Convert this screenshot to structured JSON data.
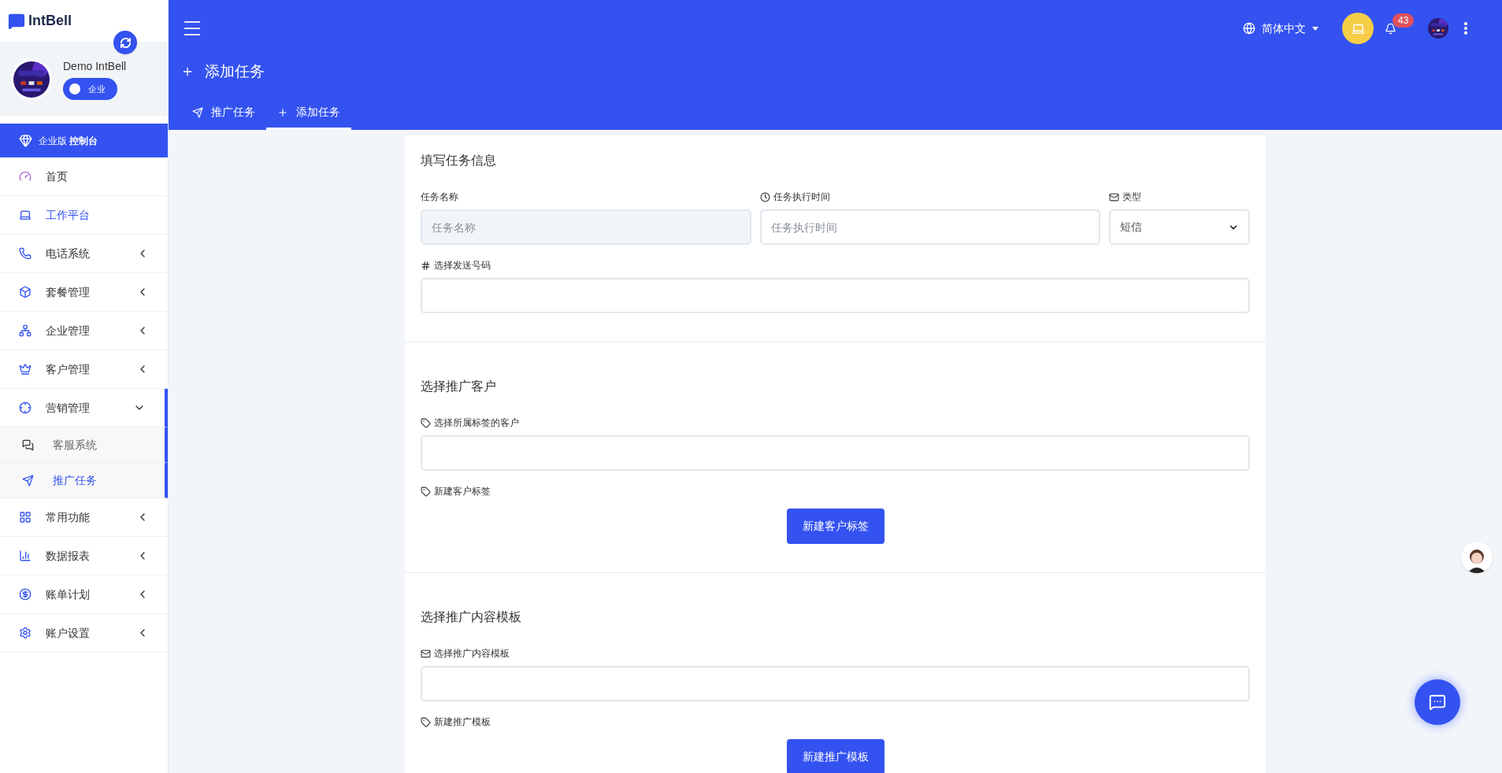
{
  "sidebar": {
    "logo": "IntBell",
    "user": {
      "name": "Demo IntBell",
      "badge": "企业"
    },
    "banner": "企业版 **控制台**",
    "menu": [
      {
        "label": "首页",
        "selected": false
      },
      {
        "label": "工作平台",
        "selected": true
      },
      {
        "label": "电话系统",
        "selected": false,
        "expanded": false
      },
      {
        "label": "套餐管理",
        "selected": false,
        "expanded": false
      },
      {
        "label": "企业管理",
        "selected": false,
        "expanded": false
      },
      {
        "label": "客户管理",
        "selected": false,
        "expanded": false
      },
      {
        "label": "营销管理",
        "selected": false,
        "expanded": true,
        "children": [
          {
            "label": "客服系统",
            "selected": false
          },
          {
            "label": "推广任务",
            "selected": true
          }
        ]
      },
      {
        "label": "常用功能",
        "selected": false,
        "expanded": false
      },
      {
        "label": "数据报表",
        "selected": false,
        "expanded": false
      },
      {
        "label": "账单计划",
        "selected": false,
        "expanded": false
      },
      {
        "label": "账户设置",
        "selected": false,
        "expanded": false
      }
    ]
  },
  "header": {
    "language": "简体中文",
    "notifications": "43",
    "page_title": "添加任务",
    "tabs": [
      {
        "label": "推广任务",
        "selected": false
      },
      {
        "label": "添加任务",
        "selected": true
      }
    ]
  },
  "sections": [
    {
      "title": "填写任务信息",
      "rows": [
        [
          {
            "kind": "input",
            "label": "任务名称",
            "placeholder": "任务名称",
            "disabled": true
          },
          {
            "kind": "input",
            "label": "任务执行时间",
            "placeholder": "任务执行时间",
            "disabled": false
          },
          {
            "kind": "select",
            "label": "类型",
            "value": "短信"
          }
        ],
        [
          {
            "kind": "input",
            "label": "选择发送号码",
            "disabled": false
          }
        ]
      ]
    },
    {
      "title": "选择推广客户",
      "rows": [
        [
          {
            "kind": "input",
            "label": "选择所属标签的客户",
            "disabled": false
          }
        ],
        [
          {
            "kind": "button",
            "label": "新建客户标签",
            "button": "新建客户标签"
          }
        ]
      ]
    },
    {
      "title": "选择推广内容模板",
      "rows": [
        [
          {
            "kind": "input",
            "label": "选择推广内容模板",
            "disabled": false
          }
        ],
        [
          {
            "kind": "button",
            "label": "新建推广模板",
            "button": "新建推广模板"
          }
        ]
      ]
    }
  ]
}
